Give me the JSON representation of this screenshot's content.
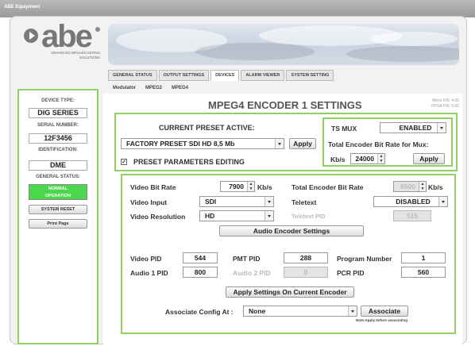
{
  "window": {
    "title": "ABE Equipment"
  },
  "logo": {
    "word": "abe",
    "tagline": "ADVANCED BROADCASTING SOLUTIONS"
  },
  "tabs": [
    {
      "label": "GENERAL STATUS"
    },
    {
      "label": "OUTPUT SETTINGS"
    },
    {
      "label": "DEVICES"
    },
    {
      "label": "ALARM VIEWER"
    },
    {
      "label": "SYSTEM SETTING"
    }
  ],
  "subtabs": [
    {
      "label": "Modulator"
    },
    {
      "label": "MPEG2"
    },
    {
      "label": "MPEG4"
    }
  ],
  "sidebar": {
    "device_type_label": "DEVICE TYPE:",
    "device_type": "DIG SERIES",
    "serial_label": "SERIAL NUMBER:",
    "serial": "12F3456",
    "ident_label": "IDENTIFICATION:",
    "ident": "DME",
    "status_label": "GENERAL STATUS:",
    "status_line1": "NORMAL",
    "status_line2": "OPERATION",
    "status_color": "#4cd84c",
    "reset_button": "SYSTEM RESET",
    "print_button": "Print Page"
  },
  "main": {
    "title": "MPEG4 ENCODER 1 SETTINGS",
    "micro_fw": "Micro FW: 4.00",
    "fpga_fw": "FPGA FW: 5.00",
    "preset": {
      "label": "CURRENT PRESET ACTIVE:",
      "selected": "FACTORY PRESET SDI HD 8,5 Mb",
      "apply_button": "Apply",
      "editing_label": "PRESET PARAMETERS EDITING",
      "editing_checked": true
    },
    "tsmux": {
      "label": "TS MUX",
      "selected": "ENABLED",
      "rate_label": "Total Encoder Bit Rate for Mux:",
      "kbs_label": "Kb/s",
      "rate_value": "24000",
      "apply_button": "Apply"
    },
    "settings": {
      "video_bitrate_label": "Video Bit Rate",
      "video_bitrate": "7900",
      "video_bitrate_unit": "Kb/s",
      "total_bitrate_label": "Total Encoder Bit Rate",
      "total_bitrate": "8500",
      "total_bitrate_unit": "Kb/s",
      "video_input_label": "Video Input",
      "video_input": "SDI",
      "teletext_label": "Teletext",
      "teletext": "DISABLED",
      "video_res_label": "Video Resolution",
      "video_res": "HD",
      "teletext_pid_label": "Teletext PID",
      "teletext_pid": "515",
      "audio_button": "Audio Encoder Settings",
      "video_pid_label": "Video PID",
      "video_pid": "544",
      "pmt_pid_label": "PMT PID",
      "pmt_pid": "288",
      "program_number_label": "Program Number",
      "program_number": "1",
      "audio1_pid_label": "Audio 1 PID",
      "audio1_pid": "800",
      "audio2_pid_label": "Audio 2 PID",
      "audio2_pid": "0",
      "pcr_pid_label": "PCR PID",
      "pcr_pid": "560",
      "apply_settings_button": "Apply Settings On Current Encoder",
      "associate_label": "Associate Config At :",
      "associate_selected": "None",
      "associate_button": "Associate",
      "note": "Note:Apply before associating"
    }
  },
  "colors": {
    "accent_green": "#8fd163",
    "status_green": "#4cd84c"
  }
}
